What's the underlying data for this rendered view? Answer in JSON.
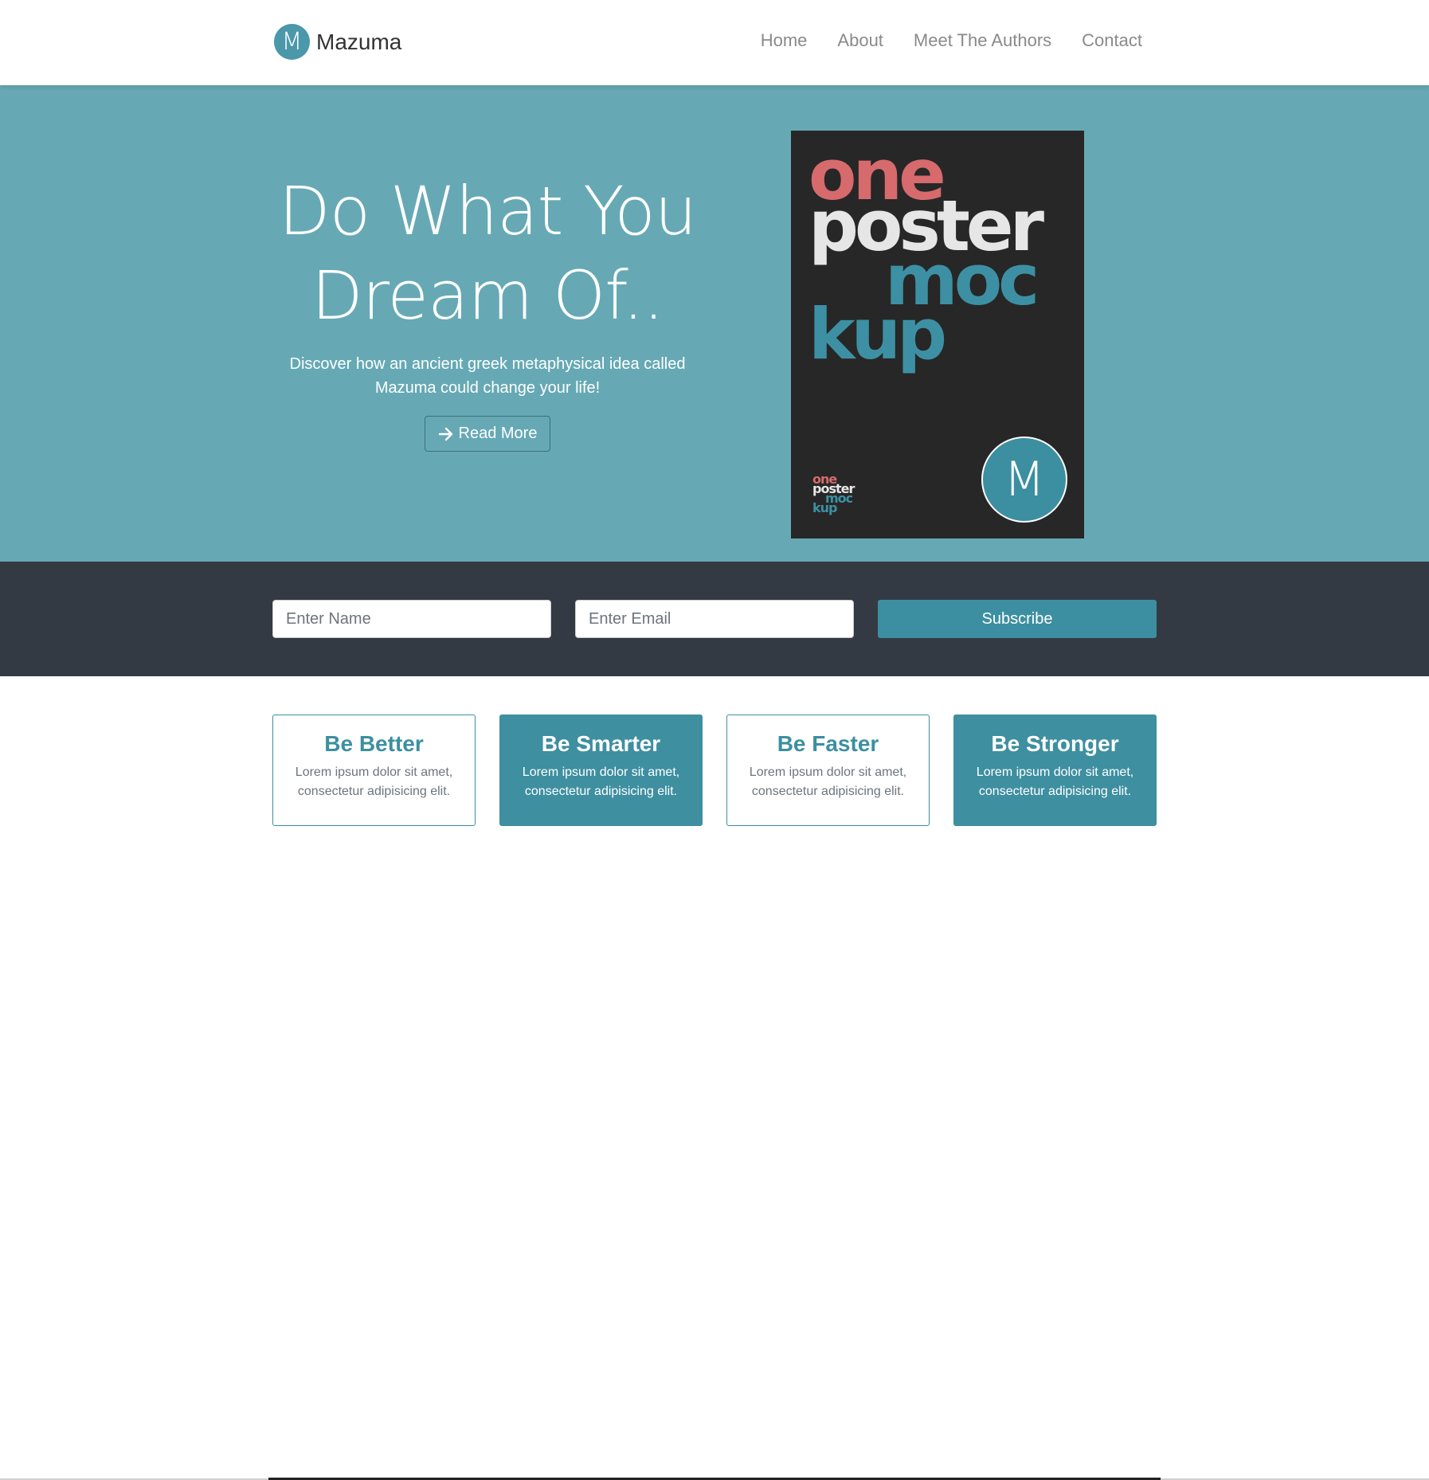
{
  "brand": {
    "logo_letter": "M",
    "name": "Mazuma"
  },
  "nav": {
    "items": [
      "Home",
      "About",
      "Meet The Authors",
      "Contact"
    ]
  },
  "hero": {
    "title_line1": "Do What You",
    "title_line2": "Dream Of..",
    "subtitle_line1": "Discover how an ancient greek metaphysical idea called",
    "subtitle_line2": "Mazuma could change your life!",
    "button_label": "Read More",
    "button_icon": "arrow-right-icon"
  },
  "poster": {
    "words": [
      "one",
      "poster",
      "moc",
      "kup"
    ],
    "badge_letter": "M"
  },
  "subscribe": {
    "name_placeholder": "Enter Name",
    "email_placeholder": "Enter Email",
    "button_label": "Subscribe"
  },
  "cards": [
    {
      "title": "Be Better",
      "text_line1": "Lorem ipsum dolor sit amet,",
      "text_line2": "consectetur adipisicing elit."
    },
    {
      "title": "Be Smarter",
      "text_line1": "Lorem ipsum dolor sit amet,",
      "text_line2": "consectetur adipisicing elit."
    },
    {
      "title": "Be Faster",
      "text_line1": "Lorem ipsum dolor sit amet,",
      "text_line2": "consectetur adipisicing elit."
    },
    {
      "title": "Be Stronger",
      "text_line1": "Lorem ipsum dolor sit amet,",
      "text_line2": "consectetur adipisicing elit."
    }
  ],
  "colors": {
    "accent": "#3c8fa1",
    "hero_bg": "#66a9b5",
    "subscribe_bg": "#343a44",
    "poster_bg": "#272727",
    "poster_red": "#d66a6d"
  }
}
